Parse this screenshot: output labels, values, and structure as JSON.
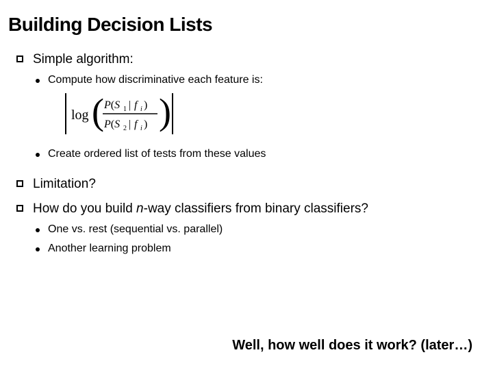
{
  "title": "Building Decision Lists",
  "items": [
    {
      "text": "Simple algorithm:",
      "sub": [
        {
          "text": "Compute how discriminative each feature is:",
          "formula": true
        },
        {
          "text": "Create ordered list of tests from these values"
        }
      ]
    },
    {
      "text": "Limitation?"
    },
    {
      "text_pre": "How do you build ",
      "text_em": "n",
      "text_post": "-way classifiers from binary classifiers?",
      "sub": [
        {
          "text": "One vs. rest (sequential vs. parallel)"
        },
        {
          "text": "Another learning problem"
        }
      ]
    }
  ],
  "formula": {
    "log": "log",
    "pnum": "P",
    "s1": "S",
    "s1sub": "1",
    "s2": "S",
    "s2sub": "2",
    "f": "f",
    "fsub": "i"
  },
  "footer": "Well, how well does it work?  (later…)"
}
